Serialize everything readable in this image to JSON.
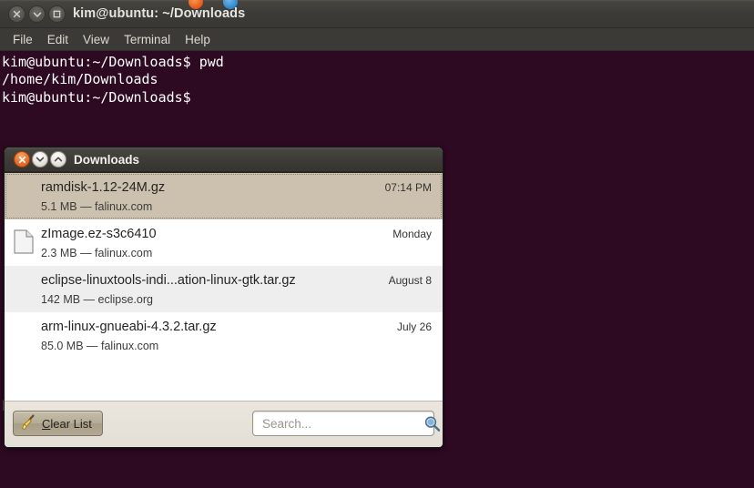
{
  "terminal": {
    "title": "kim@ubuntu: ~/Downloads",
    "window_buttons": [
      {
        "name": "close",
        "glyph": "×"
      },
      {
        "name": "minimize",
        "glyph": "∨"
      },
      {
        "name": "maximize",
        "glyph": "□"
      }
    ],
    "menu": [
      "File",
      "Edit",
      "View",
      "Terminal",
      "Help"
    ],
    "lines": [
      "kim@ubuntu:~/Downloads$ pwd",
      "/home/kim/Downloads",
      "kim@ubuntu:~/Downloads$"
    ],
    "bottom_prompt": "kim@ubuntu:~/Downloads$",
    "background_color": "#2D0922",
    "text_color": "#FFFFFF"
  },
  "downloads": {
    "title": "Downloads",
    "window_buttons": [
      {
        "name": "close",
        "glyph": "×"
      },
      {
        "name": "minimize",
        "glyph": "∨"
      },
      {
        "name": "shade",
        "glyph": "∧"
      }
    ],
    "items": [
      {
        "filename": "ramdisk-1.12-24M.gz",
        "details": "5.1 MB — falinux.com",
        "timestamp": "07:14 PM",
        "selected": true,
        "has_icon": false
      },
      {
        "filename": "zImage.ez-s3c6410",
        "details": "2.3 MB — falinux.com",
        "timestamp": "Monday",
        "selected": false,
        "has_icon": true
      },
      {
        "filename": "eclipse-linuxtools-indi...ation-linux-gtk.tar.gz",
        "details": "142 MB — eclipse.org",
        "timestamp": "August 8",
        "selected": false,
        "has_icon": false
      },
      {
        "filename": "arm-linux-gnueabi-4.3.2.tar.gz",
        "details": "85.0 MB — falinux.com",
        "timestamp": "July 26",
        "selected": false,
        "has_icon": false
      }
    ],
    "toolbar": {
      "clear_list_label_prefix": "C",
      "clear_list_label_rest": "lear List",
      "search_placeholder": "Search...",
      "search_value": ""
    },
    "selection_color": "#CBC1AE",
    "accent_close_color": "#E9702C"
  }
}
